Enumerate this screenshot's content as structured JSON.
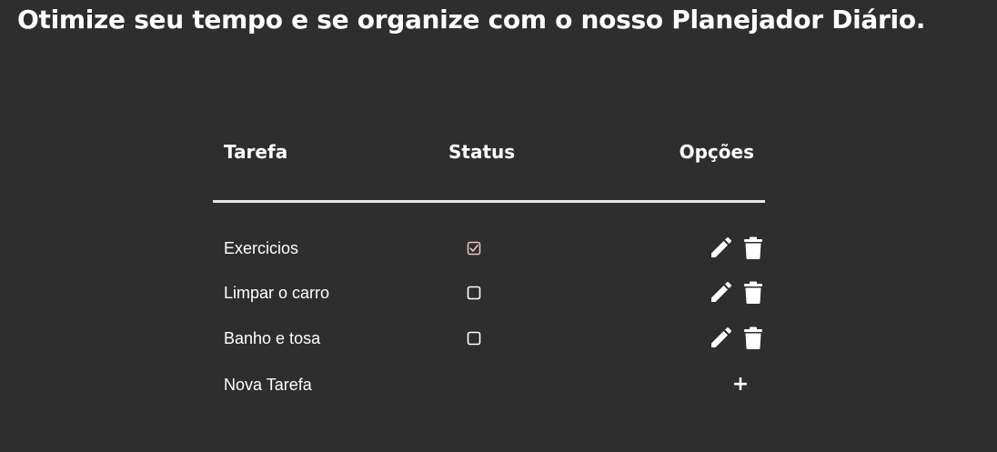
{
  "page": {
    "title": "Otimize seu tempo e se organize com o nosso Planejador Diário."
  },
  "table": {
    "headers": {
      "task": "Tarefa",
      "status": "Status",
      "options": "Opções"
    },
    "tasks": [
      {
        "name": "Exercicios",
        "done": true
      },
      {
        "name": "Limpar o carro",
        "done": false
      },
      {
        "name": "Banho e tosa",
        "done": false
      }
    ],
    "new_task_label": "Nova Tarefa",
    "add_symbol": "+"
  },
  "icons": {
    "edit": "pencil-icon",
    "delete": "trash-icon",
    "add": "plus-icon",
    "unchecked": "checkbox-unchecked-icon",
    "checked": "checkbox-checked-icon"
  },
  "colors": {
    "background": "#2e2e2e",
    "text": "#ffffff",
    "divider": "#e6e6e6",
    "checked_box": "#e8c8c8"
  }
}
